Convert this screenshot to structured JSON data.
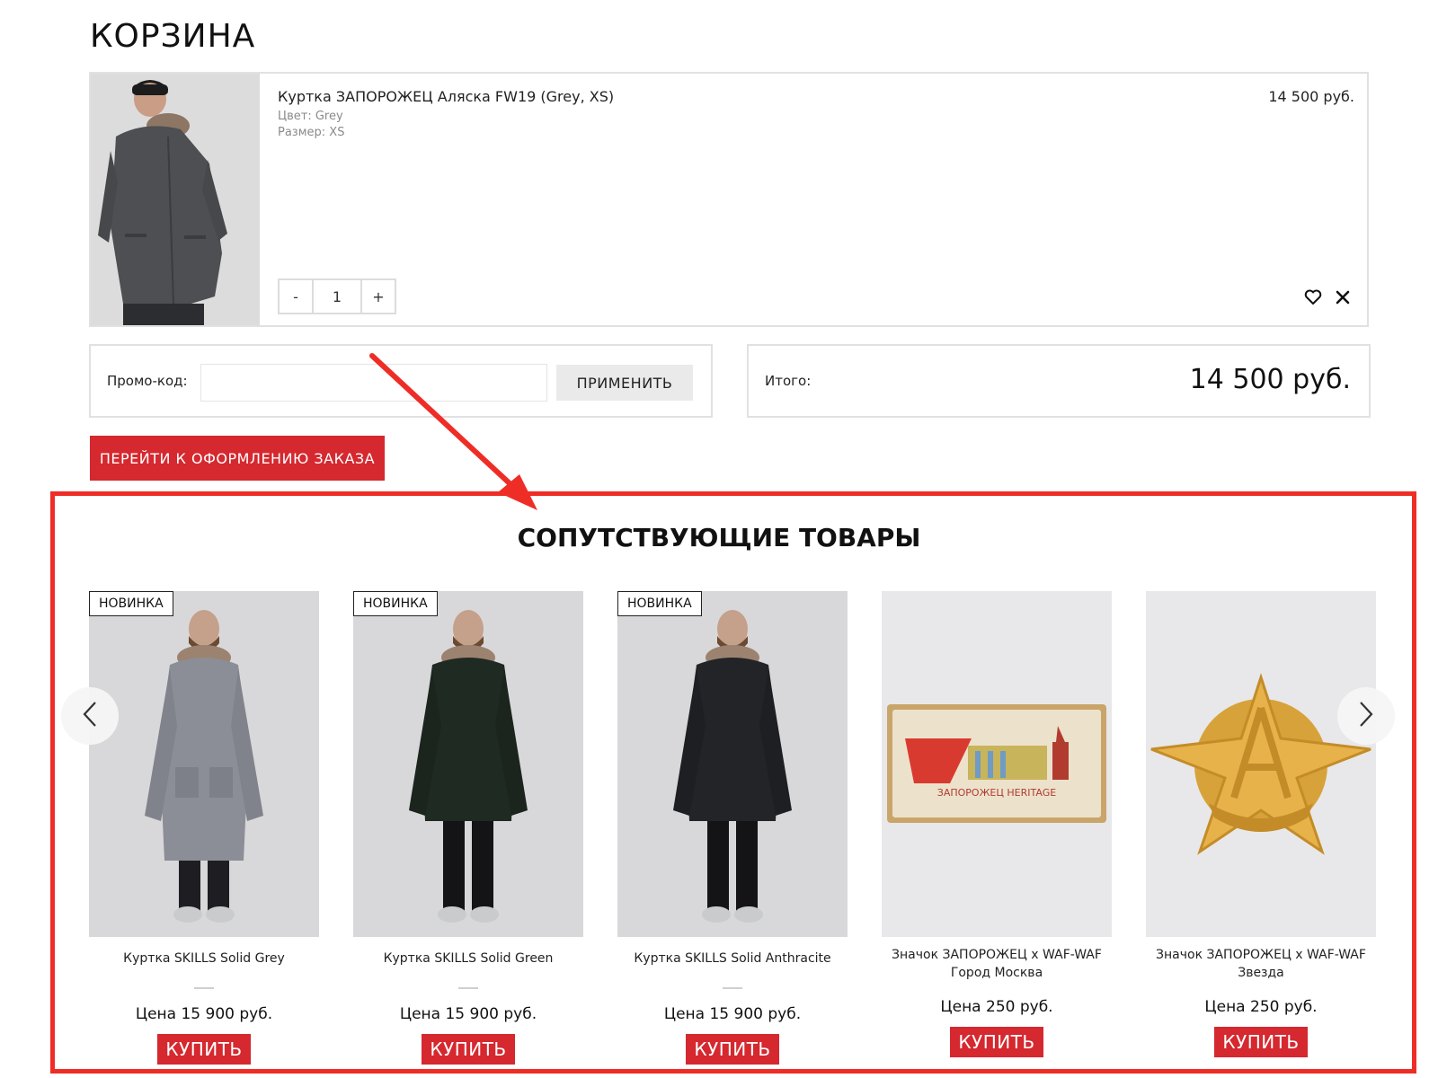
{
  "page": {
    "title": "КОРЗИНА"
  },
  "cart": {
    "item": {
      "name": "Куртка ЗАПОРОЖЕЦ Аляска FW19 (Grey, XS)",
      "color": "Цвет: Grey",
      "size": "Размер: XS",
      "price": "14 500 руб.",
      "qty_minus": "-",
      "qty_value": "1",
      "qty_plus": "+"
    },
    "promo": {
      "label": "Промо-код:",
      "value": "",
      "apply_label": "ПРИМЕНИТЬ"
    },
    "total": {
      "label": "Итого:",
      "value": "14 500 руб."
    },
    "checkout_label": "ПЕРЕЙТИ К ОФОРМЛЕНИЮ ЗАКАЗА"
  },
  "related": {
    "title": "СОПУТСТВУЮЩИЕ ТОВАРЫ",
    "products": [
      {
        "badge": "НОВИНКА",
        "name": "Куртка SKILLS Solid Grey",
        "price": "Цена 15 900 руб.",
        "buy": "КУПИТЬ"
      },
      {
        "badge": "НОВИНКА",
        "name": "Куртка SKILLS Solid Green",
        "price": "Цена 15 900 руб.",
        "buy": "КУПИТЬ"
      },
      {
        "badge": "НОВИНКА",
        "name": "Куртка SKILLS Solid Anthracite",
        "price": "Цена 15 900 руб.",
        "buy": "КУПИТЬ"
      },
      {
        "badge": "",
        "name": "Значок ЗАПОРОЖЕЦ x WAF-WAF Город Москва",
        "price": "Цена 250 руб.",
        "buy": "КУПИТЬ"
      },
      {
        "badge": "",
        "name": "Значок ЗАПОРОЖЕЦ x WAF-WAF Звезда",
        "price": "Цена 250 руб.",
        "buy": "КУПИТЬ"
      }
    ]
  },
  "badge_text": {
    "heritage": "ЗАПОРОЖЕЦ HERITAGE"
  },
  "colors": {
    "accent": "#d5282f",
    "annotation": "#ee2d26",
    "border": "#e1e1e1"
  },
  "icons": [
    "heart-icon",
    "close-icon",
    "chevron-left-icon",
    "chevron-right-icon"
  ]
}
